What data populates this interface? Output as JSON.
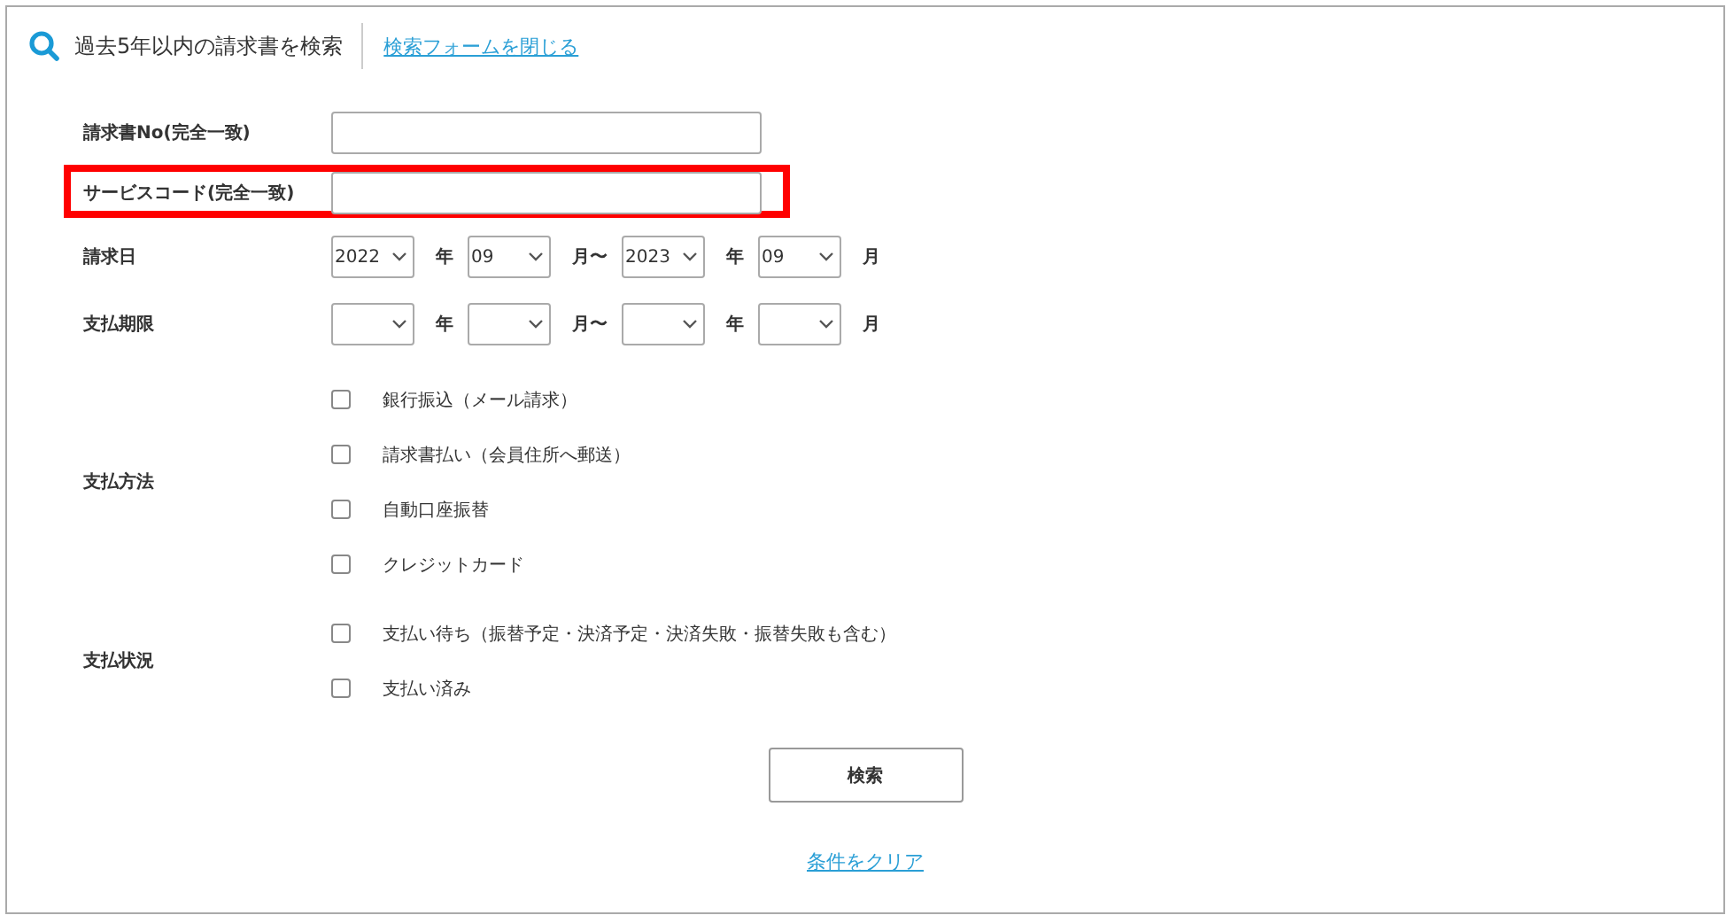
{
  "header": {
    "title": "過去5年以内の請求書を検索",
    "close_link": "検索フォームを閉じる"
  },
  "text_fields": [
    {
      "label": "請求書No(完全一致)",
      "highlighted": false
    },
    {
      "label": "サービスコード(完全一致)",
      "highlighted": true
    }
  ],
  "date_rows": [
    {
      "label": "請求日",
      "from_year": "2022",
      "year_unit": "年",
      "from_month": "09",
      "range_sep": "月〜",
      "to_year": "2023",
      "year_unit_2": "年",
      "to_month": "09",
      "month_unit": "月"
    },
    {
      "label": "支払期限",
      "year_unit": "年",
      "range_sep": "月〜",
      "year_unit_2": "年",
      "month_unit": "月"
    }
  ],
  "checkbox_groups": [
    {
      "label": "支払方法",
      "options": [
        {
          "label": "銀行振込（メール請求）",
          "checked": false
        },
        {
          "label": "請求書払い（会員住所へ郵送）",
          "checked": false
        },
        {
          "label": "自動口座振替",
          "checked": false
        },
        {
          "label": "クレジットカード",
          "checked": false
        }
      ]
    },
    {
      "label": "支払状況",
      "options": [
        {
          "label": "支払い待ち（振替予定・決済予定・決済失敗・振替失敗も含む）",
          "checked": false
        },
        {
          "label": "支払い済み",
          "checked": false
        }
      ]
    }
  ],
  "search_button": "検索",
  "clear_link": "条件をクリア"
}
